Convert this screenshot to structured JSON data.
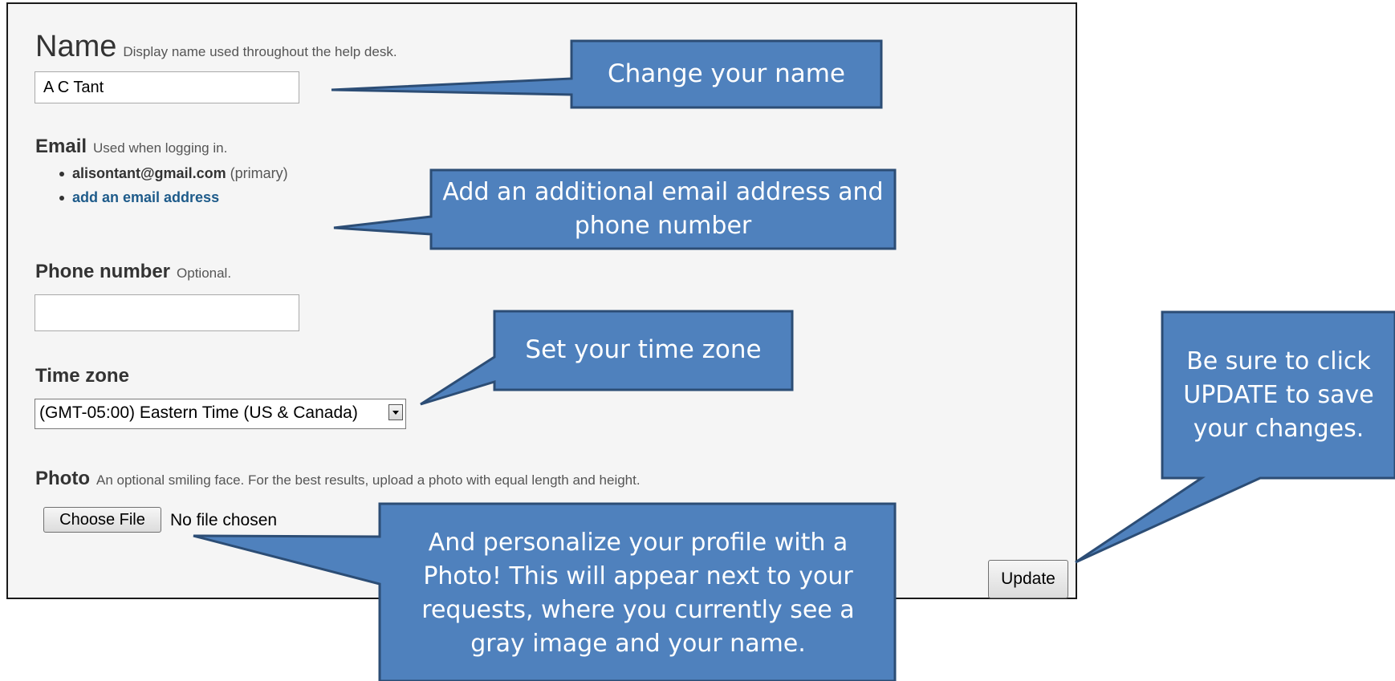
{
  "profile_form": {
    "name": {
      "label": "Name",
      "hint": "Display name used throughout the help desk.",
      "value": "A C Tant"
    },
    "email": {
      "label": "Email",
      "hint": "Used when logging in.",
      "primary_address": "alisontant@gmail.com",
      "primary_tag": "(primary)",
      "add_link": "add an email address"
    },
    "phone": {
      "label": "Phone number",
      "hint": "Optional.",
      "value": ""
    },
    "time_zone": {
      "label": "Time zone",
      "selected": "(GMT-05:00) Eastern Time (US & Canada)",
      "arrow_icon": "chevron-down-icon"
    },
    "photo": {
      "label": "Photo",
      "hint": "An optional smiling face. For the best results, upload a photo with equal length and height.",
      "choose_button": "Choose File",
      "file_status": "No file chosen"
    },
    "update_button": "Update"
  },
  "callouts": {
    "name": "Change your name",
    "email_phone": "Add an additional  email address and phone number",
    "time_zone": "Set your time zone",
    "update": "Be sure to click UPDATE to save your changes.",
    "photo": "And personalize your profile with a Photo! This will appear next to your requests, where you currently see a gray image and your name."
  },
  "colors": {
    "callout_fill": "#4f81bd",
    "callout_border": "#2c4d75",
    "form_background": "#f5f5f5",
    "link": "#1e5b8a"
  }
}
